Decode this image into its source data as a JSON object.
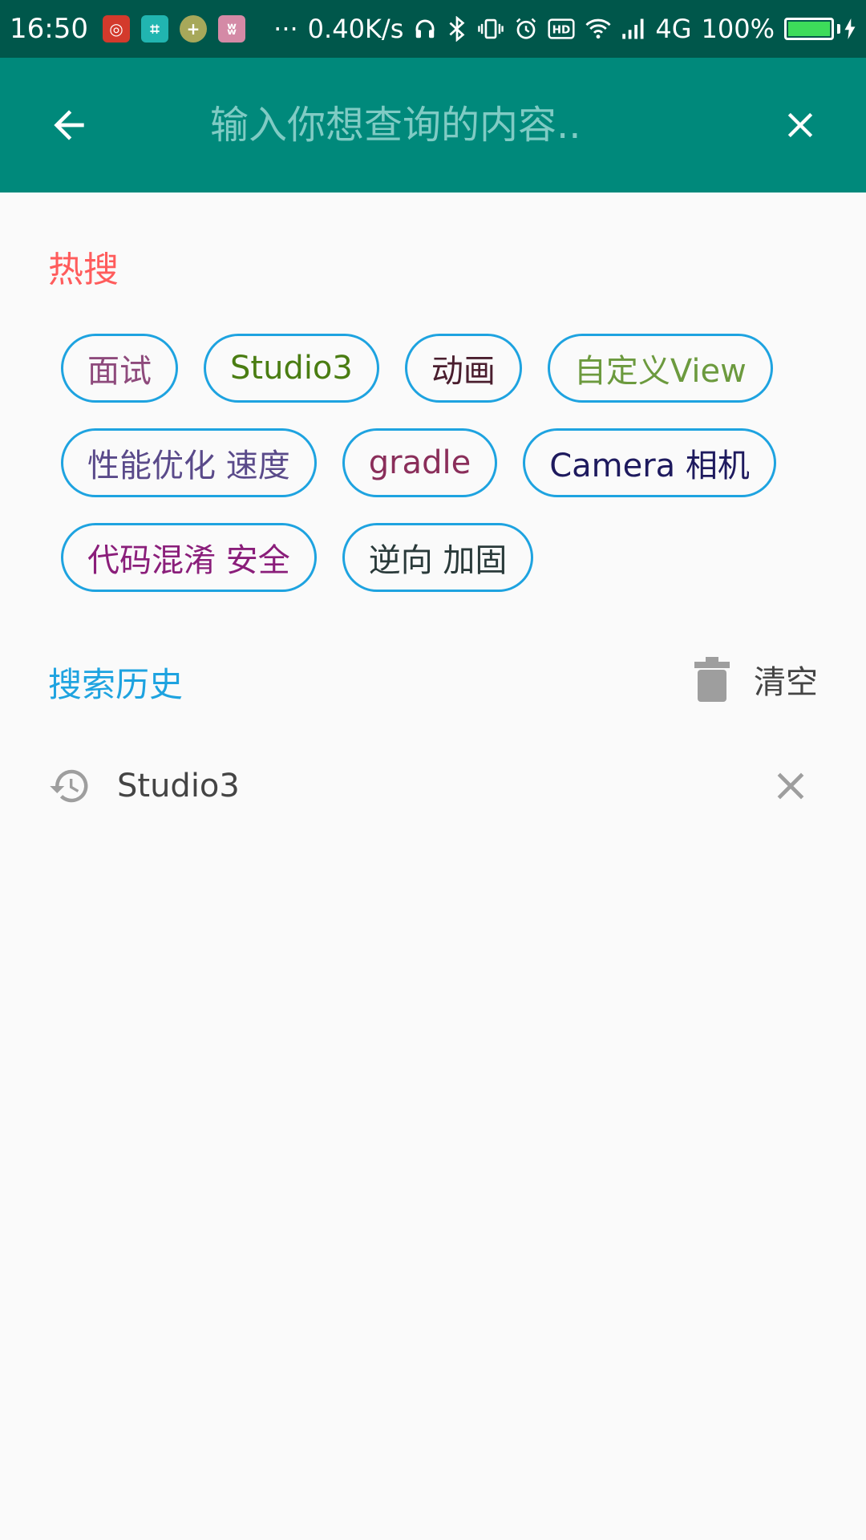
{
  "status_bar": {
    "time": "16:50",
    "net_speed": "0.40K/s",
    "network": "4G",
    "battery": "100%",
    "battery_level": 1.0,
    "app_icons": [
      {
        "name": "netease-music-icon",
        "color": "#d33a2c",
        "glyph": "◎"
      },
      {
        "name": "scanner-icon",
        "color": "#21b5b0",
        "glyph": "⌗"
      },
      {
        "name": "plus-coin-icon",
        "color": "#a7a85a",
        "glyph": "+"
      },
      {
        "name": "tuchong-icon",
        "color": "#d48aa6",
        "glyph": "ʬ"
      }
    ]
  },
  "toolbar": {
    "search_placeholder": "输入你想查询的内容..",
    "background": "#00897b"
  },
  "hot": {
    "title": "热搜",
    "tags": [
      {
        "label": "面试",
        "color": "#8e4a7c"
      },
      {
        "label": "Studio3",
        "color": "#4a7d12"
      },
      {
        "label": "动画",
        "color": "#4a1e2e"
      },
      {
        "label": "自定义View",
        "color": "#6c9a3e"
      },
      {
        "label": "性能优化 速度",
        "color": "#5a4a8a"
      },
      {
        "label": "gradle",
        "color": "#8a2e5a"
      },
      {
        "label": "Camera 相机",
        "color": "#1e1a5e"
      },
      {
        "label": "代码混淆 安全",
        "color": "#8a1e7a"
      },
      {
        "label": "逆向 加固",
        "color": "#2a3a3a"
      }
    ]
  },
  "history": {
    "title": "搜索历史",
    "clear_label": "清空",
    "items": [
      {
        "label": "Studio3"
      }
    ]
  }
}
